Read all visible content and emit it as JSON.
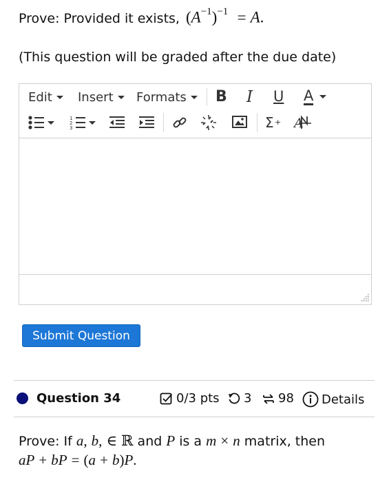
{
  "question": {
    "prompt_text": "Prove: Provided it exists,",
    "formula": {
      "open": "(",
      "inner_base": "A",
      "inner_exp": "−1",
      "close": ")",
      "outer_exp": "−1",
      "equals": "=",
      "rhs": "A",
      "period": "."
    },
    "grading_note": "(This question will be graded after the due date)"
  },
  "editor": {
    "menus": {
      "edit": "Edit",
      "insert": "Insert",
      "formats": "Formats"
    },
    "format_buttons": {
      "bold": "B",
      "italic": "I",
      "underline": "U",
      "font_color": "A"
    },
    "content": ""
  },
  "submit": {
    "label": "Submit Question"
  },
  "next_question": {
    "title": "Question 34",
    "points": "0/3 pts",
    "retries": "3",
    "attempts": "98",
    "details": "Details",
    "text_prefix": "Prove: If",
    "a": "a",
    "comma1": ",",
    "b": "b",
    "comma2": ",",
    "in": "∈",
    "reals": "ℝ",
    "and_text": "and",
    "P": "P",
    "is_a": "is a",
    "m": "m",
    "times": "×",
    "n": "n",
    "matrix_then": "matrix, then",
    "line2": {
      "a": "a",
      "P1": "P",
      "plus1": "+",
      "b": "b",
      "P2": "P",
      "eq": "=",
      "lhs_open": "(",
      "a2": "a",
      "plus2": "+",
      "b2": "b",
      "lhs_close": ")",
      "P3": "P",
      "period": "."
    }
  },
  "colors": {
    "accent": "#1c77d6",
    "dot": "#0a0f7a",
    "border": "#cfcfcf"
  }
}
